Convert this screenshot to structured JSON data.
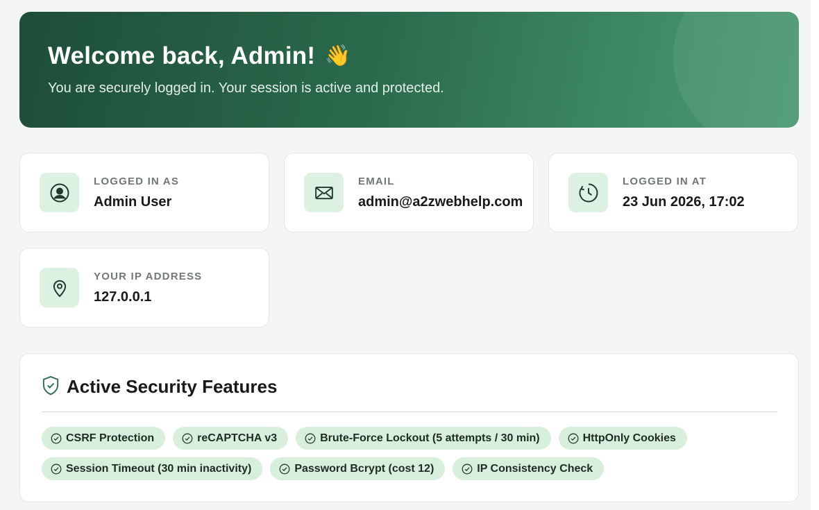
{
  "hero": {
    "title": "Welcome back, Admin!",
    "wave_emoji": "👋",
    "subtitle": "You are securely logged in. Your session is active and protected."
  },
  "cards": [
    {
      "icon": "user-circle-icon",
      "label": "LOGGED IN AS",
      "value": "Admin User"
    },
    {
      "icon": "envelope-icon",
      "label": "EMAIL",
      "value": "admin@a2zwebhelp.com"
    },
    {
      "icon": "clock-icon",
      "label": "LOGGED IN AT",
      "value": "23 Jun 2026, 17:02"
    },
    {
      "icon": "map-pin-icon",
      "label": "YOUR IP ADDRESS",
      "value": "127.0.0.1"
    }
  ],
  "security": {
    "icon": "shield-check-icon",
    "title": "Active Security Features",
    "features": [
      "CSRF Protection",
      "reCAPTCHA v3",
      "Brute-Force Lockout (5 attempts / 30 min)",
      "HttpOnly Cookies",
      "Session Timeout (30 min inactivity)",
      "Password Bcrypt (cost 12)",
      "IP Consistency Check"
    ]
  },
  "colors": {
    "hero_gradient_start": "#1e4d39",
    "hero_gradient_end": "#4a9872",
    "accent": "#2f6e50",
    "icon_tile_bg": "#ddf1e2",
    "pill_bg": "#d8efde",
    "page_bg": "#f4f6f5"
  }
}
